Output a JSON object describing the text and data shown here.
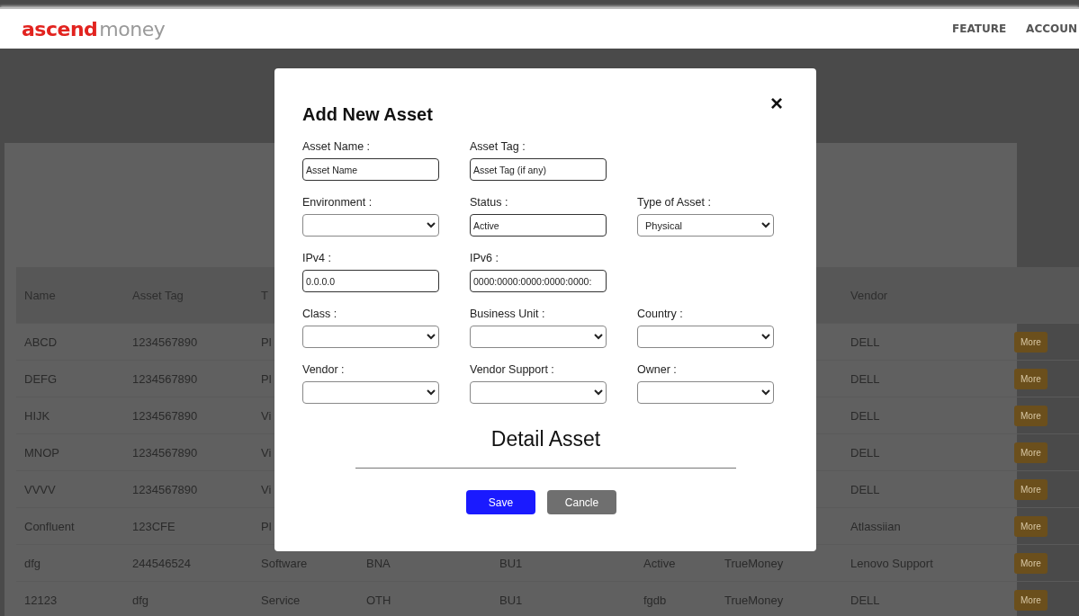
{
  "header": {
    "logo": {
      "brand": "ascend",
      "suffix": "money"
    },
    "nav": [
      {
        "label": "FEATURE"
      },
      {
        "label": "ACCOUN"
      }
    ]
  },
  "table": {
    "columns": [
      "Name",
      "Asset Tag",
      "T",
      null,
      null,
      null,
      null,
      "Vendor",
      null
    ],
    "rows": [
      {
        "cells": [
          "ABCD",
          "1234567890",
          "Pl",
          null,
          null,
          null,
          null,
          "DELL"
        ],
        "action": "More"
      },
      {
        "cells": [
          "DEFG",
          "1234567890",
          "Pl",
          null,
          null,
          null,
          null,
          "DELL"
        ],
        "action": "More"
      },
      {
        "cells": [
          "HIJK",
          "1234567890",
          "Vi",
          null,
          null,
          null,
          null,
          "DELL"
        ],
        "action": "More"
      },
      {
        "cells": [
          "MNOP",
          "1234567890",
          "Vi",
          null,
          null,
          null,
          null,
          "DELL"
        ],
        "action": "More"
      },
      {
        "cells": [
          "VVVV",
          "1234567890",
          "Vi",
          null,
          null,
          null,
          null,
          "DELL"
        ],
        "action": "More"
      },
      {
        "cells": [
          "Confluent",
          "123CFE",
          "Pl",
          null,
          null,
          null,
          null,
          "Atlassiian"
        ],
        "action": "More"
      },
      {
        "cells": [
          "dfg",
          "244546524",
          "Software",
          "BNA",
          "BU1",
          "Active",
          "TrueMoney",
          "Lenovo Support"
        ],
        "action": "More"
      },
      {
        "cells": [
          "12123",
          "dfg",
          "Service",
          "OTH",
          "BU1",
          "fgdb",
          "TrueMoney",
          "DELL"
        ],
        "action": "More"
      }
    ]
  },
  "modal": {
    "title": "Add New Asset",
    "close": "×",
    "form_rows": [
      [
        {
          "label": "Asset Name :",
          "kind": "text",
          "placeholder": "Asset Name"
        },
        {
          "label": "Asset Tag :",
          "kind": "text",
          "placeholder": "Asset Tag (if any)"
        },
        null
      ],
      [
        {
          "label": "Environment :",
          "kind": "select"
        },
        {
          "label": "Status :",
          "kind": "text",
          "value": "Active"
        },
        {
          "label": "Type of Asset :",
          "kind": "select",
          "value": "Physical"
        }
      ],
      [
        {
          "label": "IPv4 :",
          "kind": "text",
          "value": "0.0.0.0"
        },
        {
          "label": "IPv6 :",
          "kind": "text",
          "value": "0000:0000:0000:0000:0000:"
        },
        null
      ],
      [
        {
          "label": "Class :",
          "kind": "select"
        },
        {
          "label": "Business Unit :",
          "kind": "select"
        },
        {
          "label": "Country :",
          "kind": "select"
        }
      ],
      [
        {
          "label": "Vendor :",
          "kind": "select"
        },
        {
          "label": "Vendor Support :",
          "kind": "select"
        },
        {
          "label": "Owner :",
          "kind": "select"
        }
      ]
    ],
    "section_title": "Detail Asset",
    "buttons": [
      {
        "label": "Save",
        "kind": "primary"
      },
      {
        "label": "Cancle",
        "kind": "secondary"
      }
    ]
  }
}
